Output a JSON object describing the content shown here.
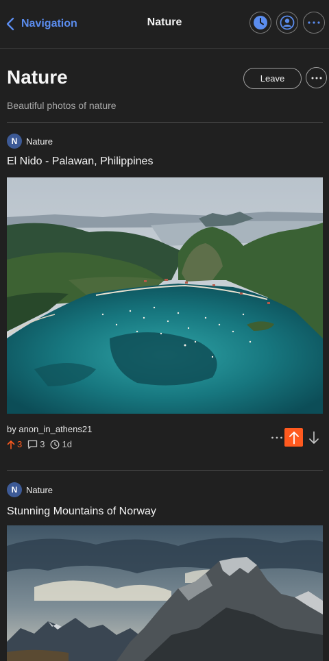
{
  "header": {
    "back_label": "Navigation",
    "title": "Nature",
    "icons": [
      "clock-icon",
      "user-icon",
      "more-horizontal-icon"
    ],
    "accent_color": "#5b8def"
  },
  "community": {
    "title": "Nature",
    "description": "Beautiful photos of nature",
    "leave_label": "Leave"
  },
  "posts": [
    {
      "community_initial": "N",
      "community_name": "Nature",
      "title": "El Nido - Palawan, Philippines",
      "author_line": "by anon_in_athens21",
      "upvotes": "3",
      "comments": "3",
      "age": "1d",
      "upvoted": true
    },
    {
      "community_initial": "N",
      "community_name": "Nature",
      "title": "Stunning Mountains of Norway"
    }
  ],
  "colors": {
    "background": "#202020",
    "upvote_active": "#ff5a1f",
    "avatar": "#3d5a96"
  }
}
